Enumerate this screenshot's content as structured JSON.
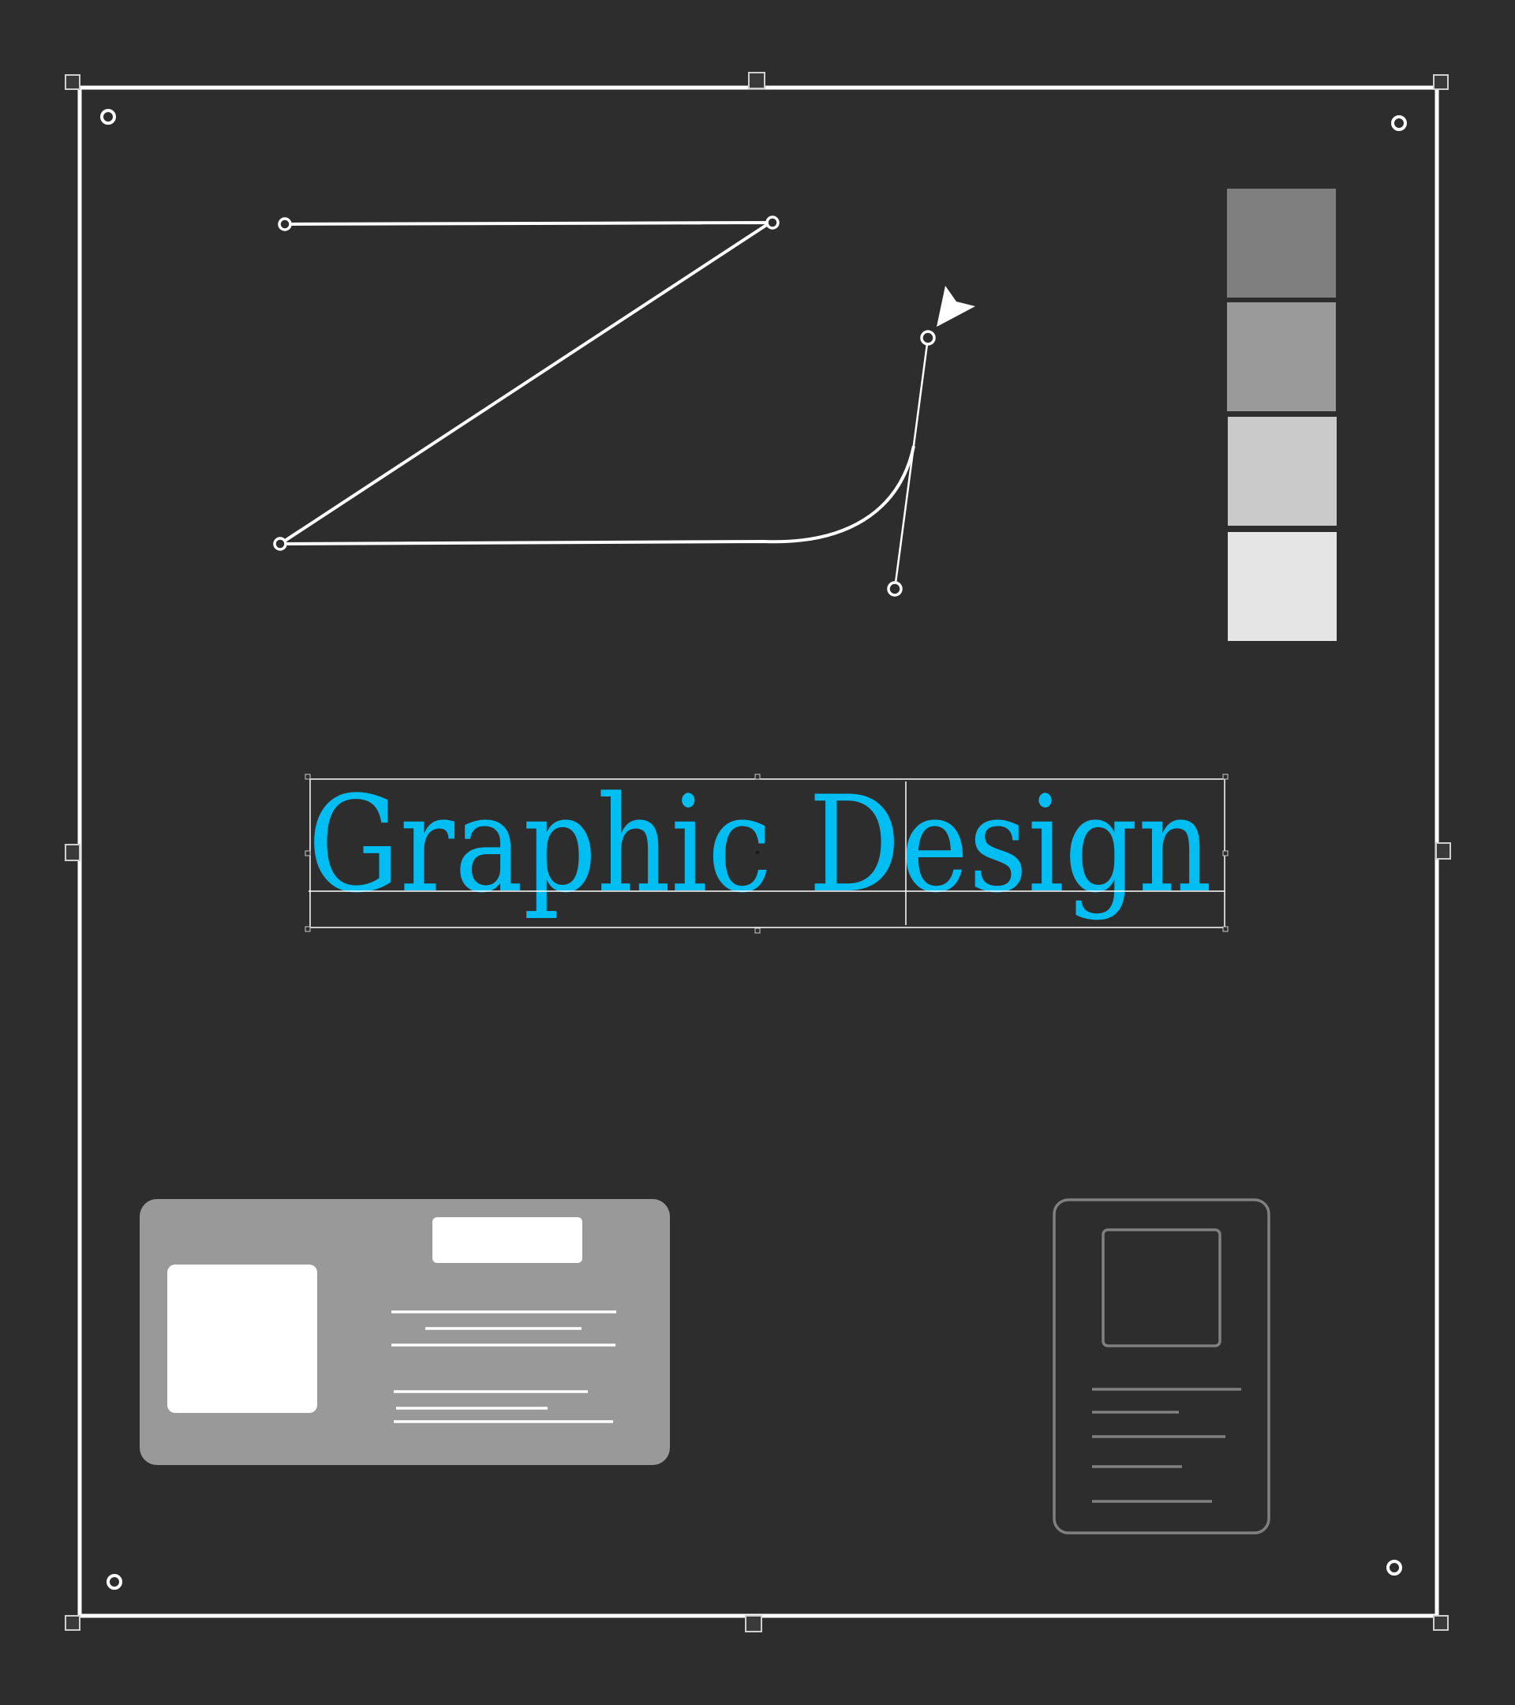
{
  "canvas": {
    "background": "#2d2d2d",
    "selection_color": "#ffffff"
  },
  "title": {
    "text": "Graphic Design",
    "color": "#00bdf2"
  },
  "swatches": [
    {
      "color": "#7f7f7f"
    },
    {
      "color": "#9a9a9a"
    },
    {
      "color": "#cacaca"
    },
    {
      "color": "#e5e5e5"
    }
  ],
  "cursor": {
    "icon": "arrow-pointer-icon",
    "color": "#ffffff"
  },
  "card_horizontal": {
    "fill": "#999999",
    "content_color": "#ffffff"
  },
  "card_vertical": {
    "stroke": "#808080"
  }
}
